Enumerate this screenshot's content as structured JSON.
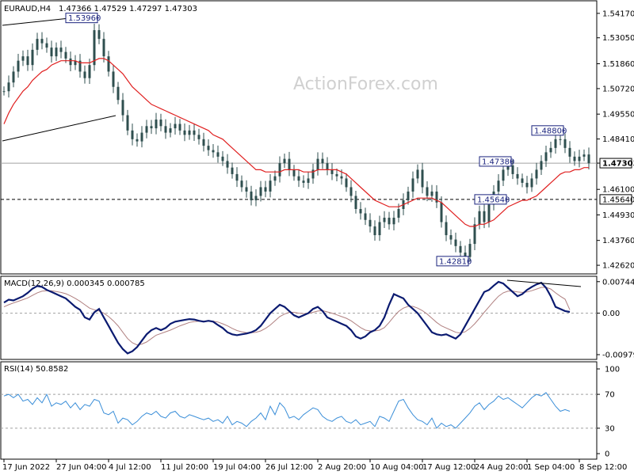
{
  "header": {
    "symbol": "EURAUD,H4",
    "ohlc": "1.47366 1.47529 1.47297 1.47303"
  },
  "watermark": "ActionForex.com",
  "colors": {
    "candle": "#2f4f4f",
    "ma": "#e02020",
    "macd": "#0a1a70",
    "signal": "#b08080",
    "rsi": "#3a8ed8",
    "text": "#000000"
  },
  "chart_data": [
    {
      "type": "line",
      "panel": "price",
      "ylim": [
        1.4226,
        1.5471
      ],
      "yticks": [
        "1.54170",
        "1.53050",
        "1.51860",
        "1.50720",
        "1.49550",
        "1.48410",
        "1.47303",
        "1.46100",
        "1.44930",
        "1.43760",
        "1.42620"
      ],
      "current_price_label": "1.47303",
      "horizontal_lines": [
        {
          "value": 1.473,
          "style": "solid"
        },
        {
          "value": 1.4564,
          "style": "dashed",
          "label": "1.45640"
        }
      ],
      "annotations": [
        {
          "label": "1.53960",
          "x_index": 19,
          "value": 1.5396
        },
        {
          "label": "1.48800",
          "x_index": 117,
          "value": 1.488
        },
        {
          "label": "1.47380",
          "x_index": 106,
          "value": 1.4738
        },
        {
          "label": "1.45640",
          "x_index": 105,
          "value": 1.4564
        },
        {
          "label": "1.42810",
          "x_index": 97,
          "value": 1.4281
        }
      ],
      "close": [
        1.506,
        1.51,
        1.515,
        1.52,
        1.522,
        1.518,
        1.525,
        1.53,
        1.528,
        1.526,
        1.522,
        1.526,
        1.524,
        1.521,
        1.518,
        1.52,
        1.515,
        1.512,
        1.518,
        1.534,
        1.53,
        1.522,
        1.515,
        1.508,
        1.502,
        1.495,
        1.488,
        1.484,
        1.483,
        1.487,
        1.49,
        1.489,
        1.493,
        1.49,
        1.487,
        1.489,
        1.491,
        1.488,
        1.486,
        1.488,
        1.486,
        1.484,
        1.481,
        1.479,
        1.478,
        1.476,
        1.474,
        1.471,
        1.468,
        1.465,
        1.462,
        1.46,
        1.456,
        1.458,
        1.462,
        1.46,
        1.465,
        1.467,
        1.473,
        1.475,
        1.47,
        1.467,
        1.465,
        1.464,
        1.466,
        1.47,
        1.475,
        1.473,
        1.47,
        1.468,
        1.467,
        1.466,
        1.462,
        1.458,
        1.452,
        1.45,
        1.447,
        1.444,
        1.44,
        1.446,
        1.448,
        1.445,
        1.448,
        1.452,
        1.456,
        1.46,
        1.466,
        1.47,
        1.462,
        1.458,
        1.46,
        1.455,
        1.446,
        1.44,
        1.438,
        1.435,
        1.432,
        1.43,
        1.436,
        1.445,
        1.451,
        1.446,
        1.454,
        1.46,
        1.465,
        1.47,
        1.472,
        1.468,
        1.466,
        1.464,
        1.462,
        1.466,
        1.47,
        1.474,
        1.478,
        1.48,
        1.484,
        1.484,
        1.48,
        1.476,
        1.474,
        1.476,
        1.477,
        1.473
      ],
      "ma": [
        1.491,
        1.496,
        1.5,
        1.503,
        1.506,
        1.508,
        1.511,
        1.513,
        1.515,
        1.516,
        1.518,
        1.519,
        1.52,
        1.52,
        1.52,
        1.52,
        1.519,
        1.519,
        1.519,
        1.52,
        1.521,
        1.521,
        1.52,
        1.518,
        1.516,
        1.514,
        1.511,
        1.508,
        1.506,
        1.504,
        1.502,
        1.5,
        1.499,
        1.498,
        1.497,
        1.496,
        1.495,
        1.494,
        1.493,
        1.492,
        1.491,
        1.49,
        1.489,
        1.488,
        1.486,
        1.485,
        1.484,
        1.482,
        1.48,
        1.478,
        1.476,
        1.474,
        1.472,
        1.47,
        1.47,
        1.469,
        1.469,
        1.469,
        1.469,
        1.47,
        1.47,
        1.47,
        1.47,
        1.469,
        1.469,
        1.469,
        1.47,
        1.47,
        1.47,
        1.47,
        1.47,
        1.469,
        1.468,
        1.466,
        1.464,
        1.462,
        1.46,
        1.458,
        1.456,
        1.455,
        1.454,
        1.453,
        1.453,
        1.453,
        1.454,
        1.455,
        1.456,
        1.457,
        1.457,
        1.457,
        1.457,
        1.456,
        1.455,
        1.453,
        1.451,
        1.449,
        1.447,
        1.445,
        1.444,
        1.444,
        1.445,
        1.445,
        1.446,
        1.447,
        1.449,
        1.451,
        1.453,
        1.454,
        1.455,
        1.456,
        1.456,
        1.457,
        1.458,
        1.46,
        1.462,
        1.464,
        1.466,
        1.468,
        1.469,
        1.469,
        1.47,
        1.47,
        1.471,
        1.471
      ]
    },
    {
      "type": "line",
      "panel": "macd",
      "title": "MACD(12,26,9) 0.000345 0.000785",
      "ylim": [
        -0.0098,
        0.0074
      ],
      "yticks": [
        "0.007441",
        "0.00",
        "-0.009794"
      ],
      "macd": [
        0.0025,
        0.0032,
        0.003,
        0.0035,
        0.004,
        0.0048,
        0.0058,
        0.0064,
        0.0062,
        0.0055,
        0.005,
        0.0045,
        0.004,
        0.0035,
        0.0025,
        0.0015,
        0.0008,
        -0.001,
        -0.0015,
        0.0002,
        0.001,
        -0.001,
        -0.003,
        -0.005,
        -0.007,
        -0.0085,
        -0.0095,
        -0.009,
        -0.008,
        -0.0065,
        -0.005,
        -0.004,
        -0.0035,
        -0.004,
        -0.0035,
        -0.0025,
        -0.002,
        -0.0018,
        -0.0016,
        -0.0014,
        -0.0015,
        -0.0018,
        -0.002,
        -0.0018,
        -0.002,
        -0.0028,
        -0.0035,
        -0.0045,
        -0.005,
        -0.0052,
        -0.005,
        -0.0048,
        -0.0045,
        -0.004,
        -0.003,
        -0.0015,
        0.0,
        0.001,
        0.002,
        0.0015,
        0.0005,
        -0.0005,
        -0.001,
        -0.0005,
        0.0,
        0.001,
        0.0015,
        0.0005,
        -0.001,
        -0.0015,
        -0.002,
        -0.0025,
        -0.003,
        -0.004,
        -0.0055,
        -0.006,
        -0.0055,
        -0.0045,
        -0.004,
        -0.003,
        -0.001,
        0.002,
        0.0045,
        0.004,
        0.0035,
        0.002,
        0.001,
        0.0,
        -0.0015,
        -0.003,
        -0.0045,
        -0.005,
        -0.0052,
        -0.005,
        -0.0055,
        -0.006,
        -0.005,
        -0.003,
        -0.001,
        0.001,
        0.003,
        0.005,
        0.0055,
        0.0065,
        0.0074,
        0.007,
        0.006,
        0.005,
        0.004,
        0.0045,
        0.0055,
        0.0062,
        0.0068,
        0.0072,
        0.006,
        0.004,
        0.0015,
        0.001,
        0.0005,
        0.0003
      ],
      "signal": [
        0.0015,
        0.002,
        0.0024,
        0.0028,
        0.0032,
        0.0036,
        0.0042,
        0.0048,
        0.0052,
        0.0053,
        0.0053,
        0.0051,
        0.0049,
        0.0046,
        0.0041,
        0.0035,
        0.0028,
        0.002,
        0.0012,
        0.0008,
        0.0005,
        0.0,
        -0.0008,
        -0.0018,
        -0.003,
        -0.0045,
        -0.006,
        -0.007,
        -0.0075,
        -0.0073,
        -0.0068,
        -0.006,
        -0.0052,
        -0.0048,
        -0.0044,
        -0.004,
        -0.0035,
        -0.003,
        -0.0026,
        -0.0022,
        -0.002,
        -0.0019,
        -0.0019,
        -0.0019,
        -0.0019,
        -0.0021,
        -0.0025,
        -0.003,
        -0.0036,
        -0.0041,
        -0.0044,
        -0.0046,
        -0.0046,
        -0.0045,
        -0.0042,
        -0.0036,
        -0.0028,
        -0.0018,
        -0.0008,
        -0.0002,
        0.0002,
        0.0002,
        0.0,
        -0.0001,
        -0.0001,
        0.0002,
        0.0005,
        0.0006,
        0.0003,
        0.0,
        -0.0004,
        -0.0008,
        -0.0012,
        -0.0018,
        -0.0026,
        -0.0034,
        -0.004,
        -0.0042,
        -0.0042,
        -0.004,
        -0.0034,
        -0.0022,
        -0.0008,
        0.0004,
        0.0012,
        0.0016,
        0.0016,
        0.0012,
        0.0006,
        -0.0002,
        -0.0012,
        -0.0022,
        -0.003,
        -0.0035,
        -0.004,
        -0.0045,
        -0.0047,
        -0.0044,
        -0.0036,
        -0.0025,
        -0.0012,
        0.0002,
        0.0015,
        0.0028,
        0.004,
        0.0048,
        0.0052,
        0.0052,
        0.005,
        0.0049,
        0.005,
        0.0053,
        0.0057,
        0.0061,
        0.0061,
        0.0057,
        0.0048,
        0.004,
        0.0033,
        0.0008
      ]
    },
    {
      "type": "line",
      "panel": "rsi",
      "title": "RSI(14) 50.8582",
      "ylim": [
        0,
        100
      ],
      "yticks": [
        "100",
        "70",
        "30",
        "0"
      ],
      "levels": [
        70,
        30
      ],
      "values": [
        68,
        70,
        66,
        70,
        62,
        64,
        58,
        66,
        60,
        70,
        56,
        60,
        58,
        62,
        54,
        60,
        52,
        58,
        56,
        64,
        62,
        48,
        46,
        50,
        36,
        42,
        40,
        34,
        38,
        44,
        48,
        46,
        50,
        44,
        42,
        48,
        50,
        44,
        42,
        46,
        44,
        42,
        40,
        42,
        38,
        40,
        36,
        44,
        34,
        38,
        36,
        32,
        38,
        42,
        48,
        40,
        56,
        46,
        60,
        54,
        42,
        44,
        40,
        46,
        50,
        54,
        52,
        44,
        40,
        38,
        42,
        44,
        38,
        36,
        40,
        34,
        36,
        38,
        32,
        44,
        42,
        38,
        50,
        62,
        64,
        54,
        46,
        40,
        38,
        34,
        42,
        30,
        36,
        32,
        34,
        30,
        36,
        42,
        48,
        56,
        60,
        52,
        58,
        62,
        68,
        64,
        66,
        62,
        58,
        54,
        60,
        66,
        70,
        68,
        72,
        64,
        56,
        50,
        52,
        50
      ]
    },
    {
      "type": "line",
      "panel": "x-axis",
      "x_tick_labels": [
        "17 Jun 2022",
        "27 Jun 04:00",
        "4 Jul 12:00",
        "11 Jul 20:00",
        "19 Jul 04:00",
        "26 Jul 12:00",
        "2 Aug 20:00",
        "10 Aug 04:00",
        "17 Aug 12:00",
        "24 Aug 20:00",
        "1 Sep 04:00",
        "8 Sep 12:00"
      ],
      "x_tick_indices": [
        0,
        11,
        22,
        33,
        44,
        55,
        66,
        77,
        88,
        99,
        110,
        121
      ]
    }
  ]
}
